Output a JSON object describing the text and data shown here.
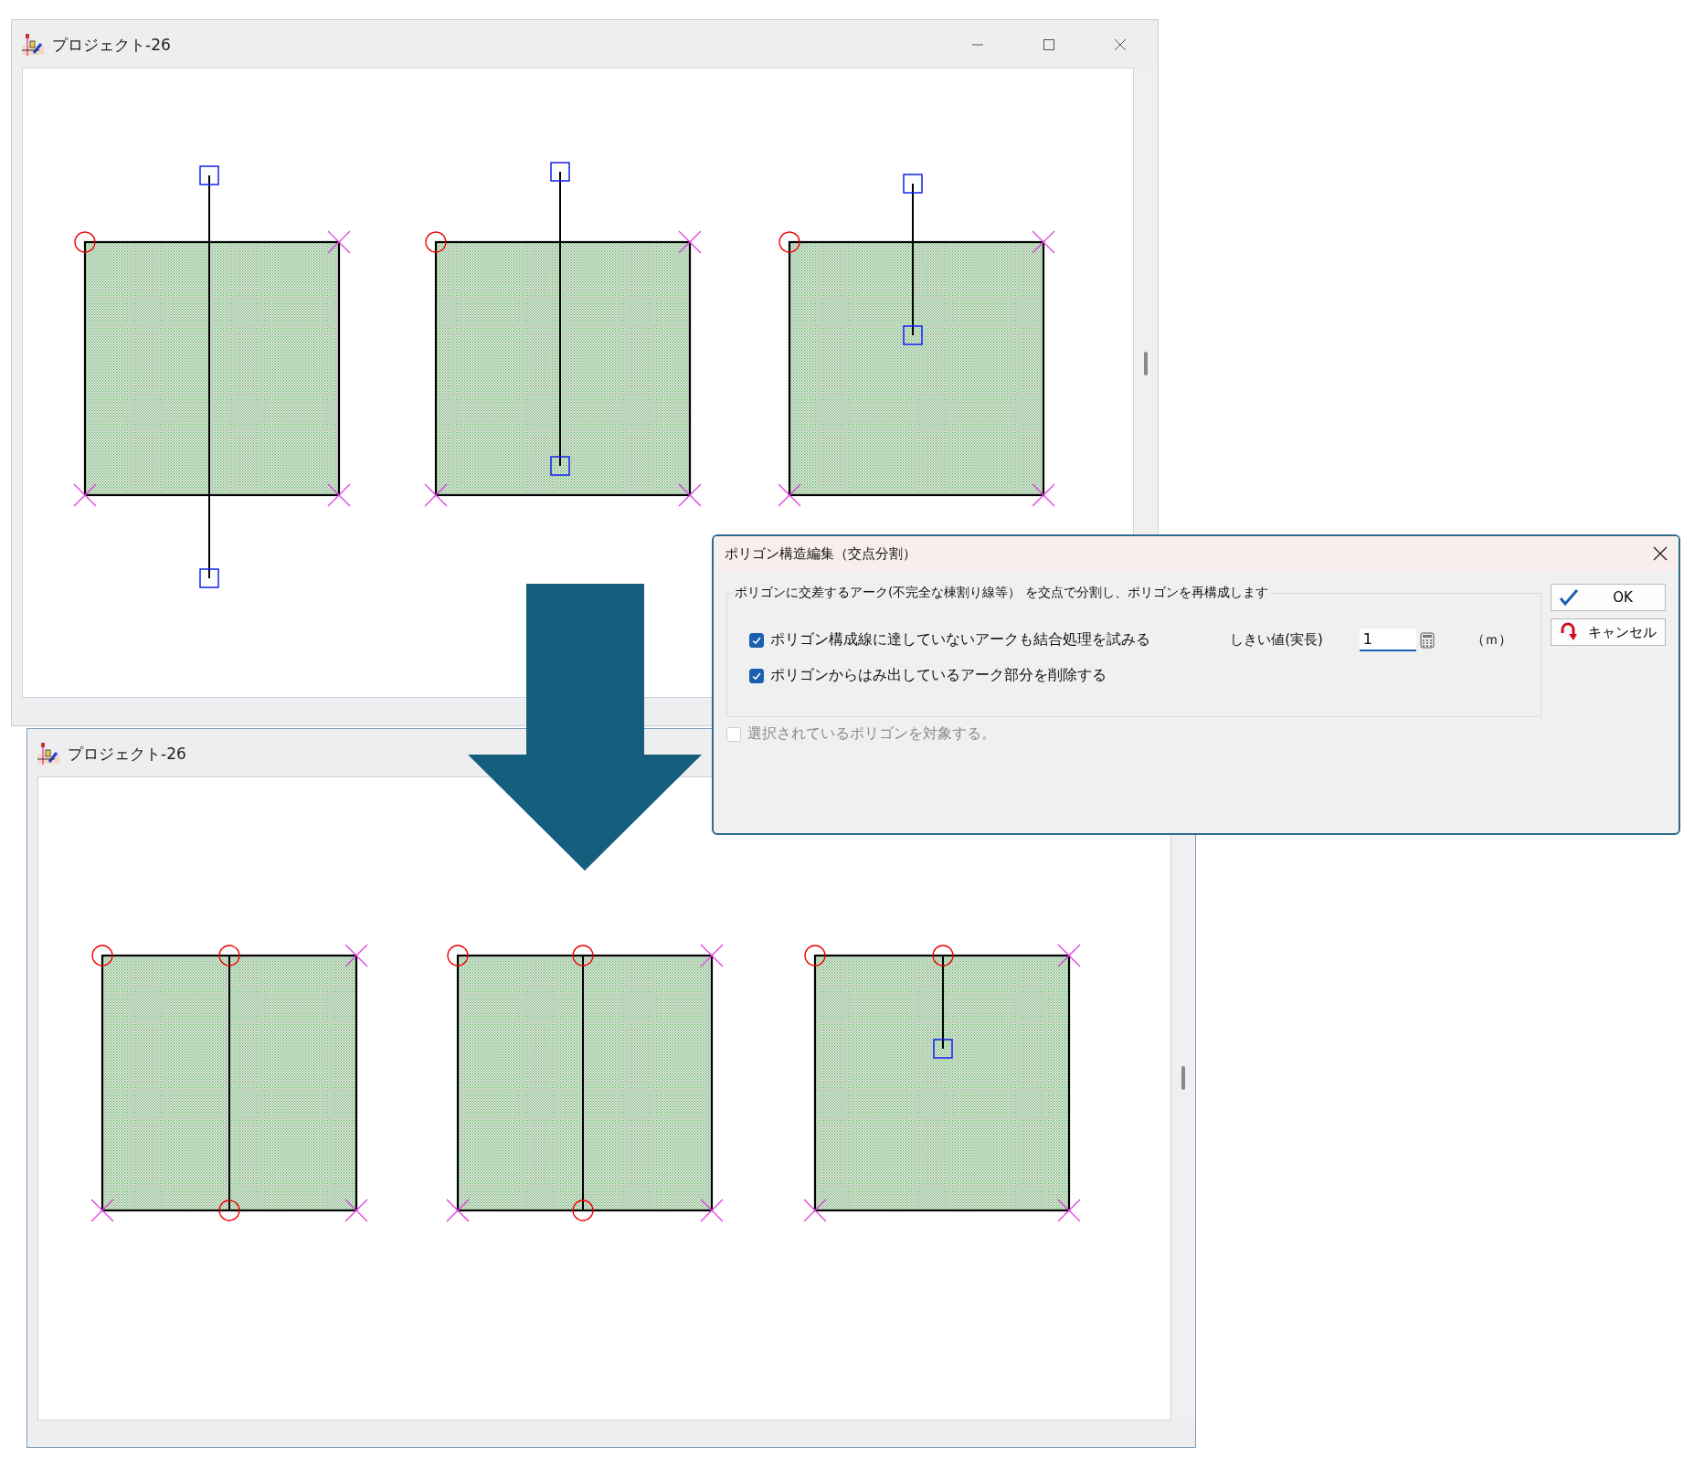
{
  "windows": [
    {
      "title": "プロジェクト-26",
      "kind": "before"
    },
    {
      "title": "プロジェクト-26",
      "kind": "after"
    }
  ],
  "dialog": {
    "title": "ポリゴン構造編集（交点分割）",
    "group_label": "ポリゴンに交差するアーク(不完全な棟割り線等） を交点で分割し、ポリゴンを再構成します",
    "options": [
      {
        "label": "ポリゴン構成線に達していないアークも結合処理を試みる",
        "checked": true,
        "disabled": false
      },
      {
        "label": "ポリゴンからはみ出しているアーク部分を削除する",
        "checked": true,
        "disabled": false
      }
    ],
    "threshold": {
      "label": "しきい値(実長)",
      "value": "1",
      "unit": "（ｍ）"
    },
    "target_option": {
      "label": "選択されているポリゴンを対象する。",
      "checked": false,
      "disabled": true
    },
    "buttons": [
      {
        "label": "OK",
        "kind": "ok"
      },
      {
        "label": "キャンセル",
        "kind": "cancel"
      }
    ]
  }
}
